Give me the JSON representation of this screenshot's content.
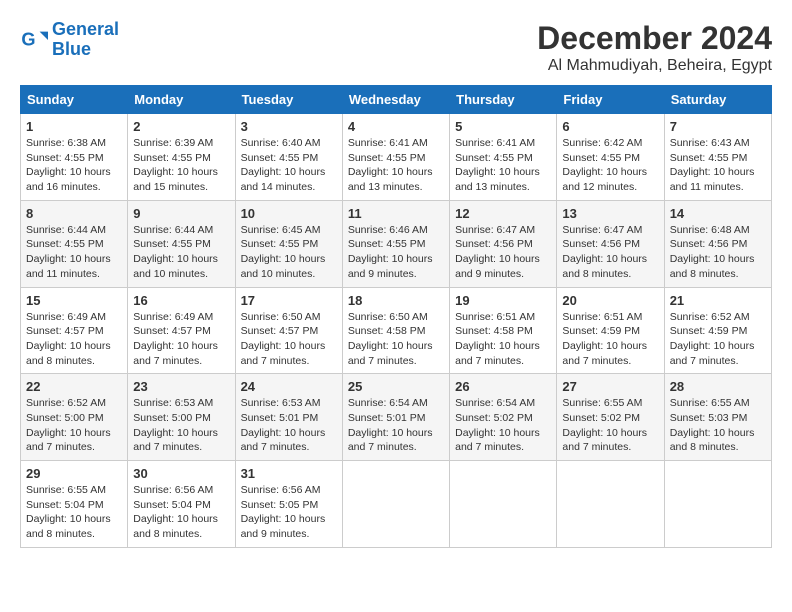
{
  "logo": {
    "line1": "General",
    "line2": "Blue"
  },
  "title": "December 2024",
  "subtitle": "Al Mahmudiyah, Beheira, Egypt",
  "days_of_week": [
    "Sunday",
    "Monday",
    "Tuesday",
    "Wednesday",
    "Thursday",
    "Friday",
    "Saturday"
  ],
  "weeks": [
    [
      {
        "day": "1",
        "info": "Sunrise: 6:38 AM\nSunset: 4:55 PM\nDaylight: 10 hours and 16 minutes."
      },
      {
        "day": "2",
        "info": "Sunrise: 6:39 AM\nSunset: 4:55 PM\nDaylight: 10 hours and 15 minutes."
      },
      {
        "day": "3",
        "info": "Sunrise: 6:40 AM\nSunset: 4:55 PM\nDaylight: 10 hours and 14 minutes."
      },
      {
        "day": "4",
        "info": "Sunrise: 6:41 AM\nSunset: 4:55 PM\nDaylight: 10 hours and 13 minutes."
      },
      {
        "day": "5",
        "info": "Sunrise: 6:41 AM\nSunset: 4:55 PM\nDaylight: 10 hours and 13 minutes."
      },
      {
        "day": "6",
        "info": "Sunrise: 6:42 AM\nSunset: 4:55 PM\nDaylight: 10 hours and 12 minutes."
      },
      {
        "day": "7",
        "info": "Sunrise: 6:43 AM\nSunset: 4:55 PM\nDaylight: 10 hours and 11 minutes."
      }
    ],
    [
      {
        "day": "8",
        "info": "Sunrise: 6:44 AM\nSunset: 4:55 PM\nDaylight: 10 hours and 11 minutes."
      },
      {
        "day": "9",
        "info": "Sunrise: 6:44 AM\nSunset: 4:55 PM\nDaylight: 10 hours and 10 minutes."
      },
      {
        "day": "10",
        "info": "Sunrise: 6:45 AM\nSunset: 4:55 PM\nDaylight: 10 hours and 10 minutes."
      },
      {
        "day": "11",
        "info": "Sunrise: 6:46 AM\nSunset: 4:55 PM\nDaylight: 10 hours and 9 minutes."
      },
      {
        "day": "12",
        "info": "Sunrise: 6:47 AM\nSunset: 4:56 PM\nDaylight: 10 hours and 9 minutes."
      },
      {
        "day": "13",
        "info": "Sunrise: 6:47 AM\nSunset: 4:56 PM\nDaylight: 10 hours and 8 minutes."
      },
      {
        "day": "14",
        "info": "Sunrise: 6:48 AM\nSunset: 4:56 PM\nDaylight: 10 hours and 8 minutes."
      }
    ],
    [
      {
        "day": "15",
        "info": "Sunrise: 6:49 AM\nSunset: 4:57 PM\nDaylight: 10 hours and 8 minutes."
      },
      {
        "day": "16",
        "info": "Sunrise: 6:49 AM\nSunset: 4:57 PM\nDaylight: 10 hours and 7 minutes."
      },
      {
        "day": "17",
        "info": "Sunrise: 6:50 AM\nSunset: 4:57 PM\nDaylight: 10 hours and 7 minutes."
      },
      {
        "day": "18",
        "info": "Sunrise: 6:50 AM\nSunset: 4:58 PM\nDaylight: 10 hours and 7 minutes."
      },
      {
        "day": "19",
        "info": "Sunrise: 6:51 AM\nSunset: 4:58 PM\nDaylight: 10 hours and 7 minutes."
      },
      {
        "day": "20",
        "info": "Sunrise: 6:51 AM\nSunset: 4:59 PM\nDaylight: 10 hours and 7 minutes."
      },
      {
        "day": "21",
        "info": "Sunrise: 6:52 AM\nSunset: 4:59 PM\nDaylight: 10 hours and 7 minutes."
      }
    ],
    [
      {
        "day": "22",
        "info": "Sunrise: 6:52 AM\nSunset: 5:00 PM\nDaylight: 10 hours and 7 minutes."
      },
      {
        "day": "23",
        "info": "Sunrise: 6:53 AM\nSunset: 5:00 PM\nDaylight: 10 hours and 7 minutes."
      },
      {
        "day": "24",
        "info": "Sunrise: 6:53 AM\nSunset: 5:01 PM\nDaylight: 10 hours and 7 minutes."
      },
      {
        "day": "25",
        "info": "Sunrise: 6:54 AM\nSunset: 5:01 PM\nDaylight: 10 hours and 7 minutes."
      },
      {
        "day": "26",
        "info": "Sunrise: 6:54 AM\nSunset: 5:02 PM\nDaylight: 10 hours and 7 minutes."
      },
      {
        "day": "27",
        "info": "Sunrise: 6:55 AM\nSunset: 5:02 PM\nDaylight: 10 hours and 7 minutes."
      },
      {
        "day": "28",
        "info": "Sunrise: 6:55 AM\nSunset: 5:03 PM\nDaylight: 10 hours and 8 minutes."
      }
    ],
    [
      {
        "day": "29",
        "info": "Sunrise: 6:55 AM\nSunset: 5:04 PM\nDaylight: 10 hours and 8 minutes."
      },
      {
        "day": "30",
        "info": "Sunrise: 6:56 AM\nSunset: 5:04 PM\nDaylight: 10 hours and 8 minutes."
      },
      {
        "day": "31",
        "info": "Sunrise: 6:56 AM\nSunset: 5:05 PM\nDaylight: 10 hours and 9 minutes."
      },
      null,
      null,
      null,
      null
    ]
  ]
}
